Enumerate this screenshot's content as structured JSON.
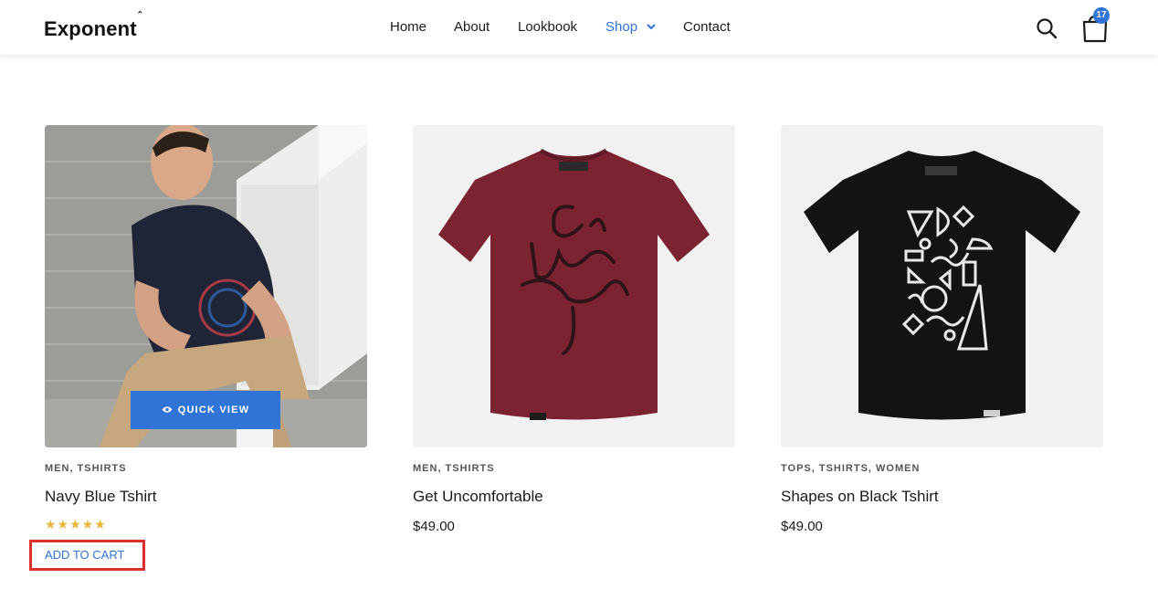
{
  "header": {
    "logo": "Exponent",
    "nav": [
      {
        "label": "Home"
      },
      {
        "label": "About"
      },
      {
        "label": "Lookbook"
      },
      {
        "label": "Shop"
      },
      {
        "label": "Contact"
      }
    ],
    "cart_count": "17",
    "icons": {
      "search": "search-icon",
      "cart": "shopping-bag-icon",
      "dropdown": "chevron-down-icon"
    },
    "accent_color": "#2f74d6"
  },
  "products": [
    {
      "categories": "MEN, TSHIRTS",
      "name": "Navy Blue Tshirt",
      "rating": 5,
      "stars": "★★★★★",
      "quick_view": "QUICK VIEW",
      "add_to_cart": "ADD TO CART"
    },
    {
      "categories": "MEN, TSHIRTS",
      "name": "Get Uncomfortable",
      "price": "$49.00"
    },
    {
      "categories": "TOPS, TSHIRTS, WOMEN",
      "name": "Shapes on Black Tshirt",
      "price": "$49.00"
    }
  ]
}
